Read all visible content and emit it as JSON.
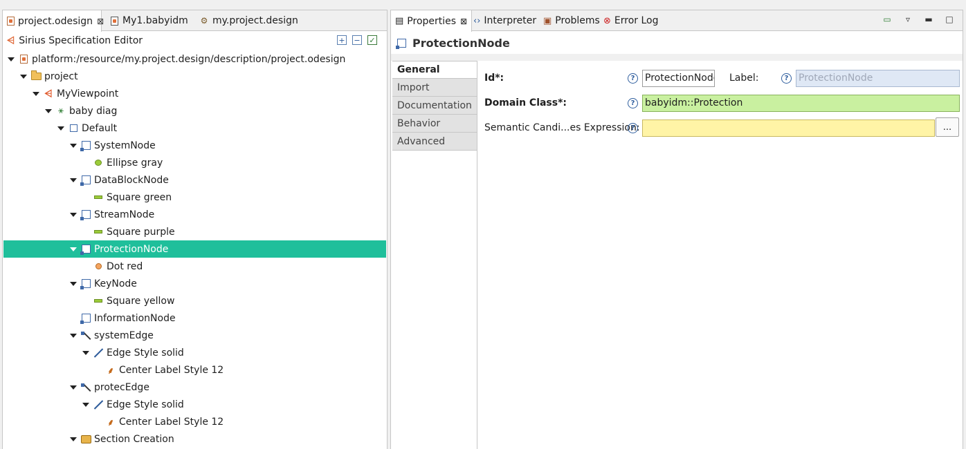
{
  "editor_tabs": [
    {
      "label": "project.odesign",
      "active": true,
      "closable": true
    },
    {
      "label": "My1.babyidm",
      "active": false
    },
    {
      "label": "my.project.design",
      "active": false
    }
  ],
  "editor": {
    "title": "Sirius Specification Editor",
    "header_buttons": [
      "expand-all-icon",
      "collapse-all-icon",
      "validate-icon"
    ]
  },
  "tree": [
    {
      "label": "platform:/resource/my.project.design/description/project.odesign",
      "depth": 0,
      "icon": "odesign-file-icon",
      "expanded": true
    },
    {
      "label": "project",
      "depth": 1,
      "icon": "folder-icon",
      "expanded": true
    },
    {
      "label": "MyViewpoint",
      "depth": 2,
      "icon": "viewpoint-icon",
      "expanded": true
    },
    {
      "label": "baby diag",
      "depth": 3,
      "icon": "diagram-description-icon",
      "expanded": true
    },
    {
      "label": "Default",
      "depth": 4,
      "icon": "layer-icon",
      "expanded": true
    },
    {
      "label": "SystemNode",
      "depth": 5,
      "icon": "node-mapping-icon",
      "expanded": true
    },
    {
      "label": "Ellipse gray",
      "depth": 6,
      "icon": "ellipse-style-icon"
    },
    {
      "label": "DataBlockNode",
      "depth": 5,
      "icon": "node-mapping-icon",
      "expanded": true
    },
    {
      "label": "Square green",
      "depth": 6,
      "icon": "square-style-icon"
    },
    {
      "label": "StreamNode",
      "depth": 5,
      "icon": "node-mapping-icon",
      "expanded": true
    },
    {
      "label": "Square purple",
      "depth": 6,
      "icon": "square-style-icon"
    },
    {
      "label": "ProtectionNode",
      "depth": 5,
      "icon": "node-mapping-icon",
      "expanded": true,
      "selected": true
    },
    {
      "label": "Dot red",
      "depth": 6,
      "icon": "dot-style-icon"
    },
    {
      "label": "KeyNode",
      "depth": 5,
      "icon": "node-mapping-icon",
      "expanded": true
    },
    {
      "label": "Square yellow",
      "depth": 6,
      "icon": "square-style-icon"
    },
    {
      "label": "InformationNode",
      "depth": 5,
      "icon": "node-mapping-icon"
    },
    {
      "label": "systemEdge",
      "depth": 5,
      "icon": "edge-mapping-icon",
      "expanded": true
    },
    {
      "label": "Edge Style solid",
      "depth": 6,
      "icon": "edge-style-icon",
      "expanded": true
    },
    {
      "label": "Center Label Style 12",
      "depth": 7,
      "icon": "label-style-icon"
    },
    {
      "label": "protecEdge",
      "depth": 5,
      "icon": "edge-mapping-icon",
      "expanded": true
    },
    {
      "label": "Edge Style solid",
      "depth": 6,
      "icon": "edge-style-icon",
      "expanded": true
    },
    {
      "label": "Center Label Style 12",
      "depth": 7,
      "icon": "label-style-icon"
    },
    {
      "label": "Section Creation",
      "depth": 5,
      "icon": "section-icon",
      "expanded": true
    }
  ],
  "view_tabs": [
    {
      "label": "Properties",
      "active": true,
      "closable": true
    },
    {
      "label": "Interpreter"
    },
    {
      "label": "Problems"
    },
    {
      "label": "Error Log"
    }
  ],
  "properties": {
    "title": "ProtectionNode",
    "tabs": [
      "General",
      "Import",
      "Documentation",
      "Behavior",
      "Advanced"
    ],
    "active_tab": "General",
    "id_label": "Id*:",
    "id_value": "ProtectionNode",
    "label_label": "Label:",
    "label_placeholder": "ProtectionNode",
    "domain_class_label": "Domain Class*:",
    "domain_class_value": "babyidm::Protection",
    "semantic_label": "Semantic Candi...es Expression:",
    "semantic_value": "",
    "browse_button": "..."
  },
  "colors": {
    "selection": "#1fbf9b",
    "domain_class_bg": "#c9f0a0",
    "expression_bg": "#fff4a6",
    "help_icon": "#2f5e9e"
  }
}
